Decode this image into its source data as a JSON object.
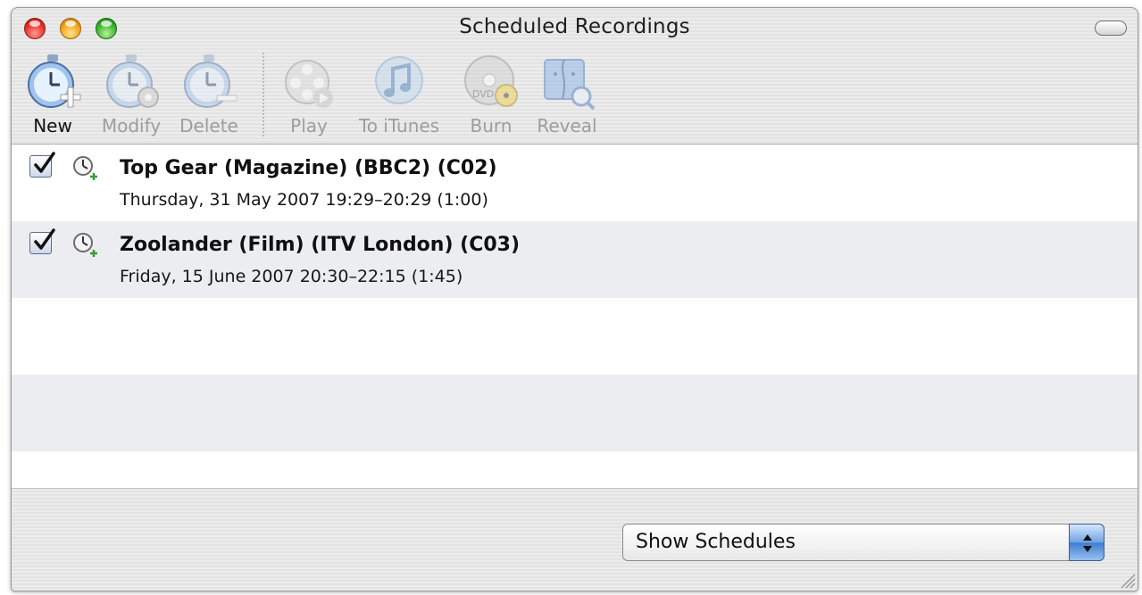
{
  "window": {
    "title": "Scheduled Recordings"
  },
  "toolbar": {
    "items": [
      {
        "label": "New",
        "icon": "stopwatch-add-icon",
        "enabled": true
      },
      {
        "label": "Modify",
        "icon": "stopwatch-modify-icon",
        "enabled": false
      },
      {
        "label": "Delete",
        "icon": "stopwatch-delete-icon",
        "enabled": false
      },
      {
        "label": "Play",
        "icon": "film-reel-play-icon",
        "enabled": false
      },
      {
        "label": "To iTunes",
        "icon": "itunes-note-icon",
        "enabled": false
      },
      {
        "label": "Burn",
        "icon": "dvd-burn-icon",
        "enabled": false
      },
      {
        "label": "Reveal",
        "icon": "finder-reveal-icon",
        "enabled": false
      }
    ]
  },
  "recordings": [
    {
      "checked": true,
      "title": "Top Gear (Magazine) (BBC2) (C02)",
      "time": "Thursday, 31 May 2007  19:29–20:29 (1:00)"
    },
    {
      "checked": true,
      "title": "Zoolander (Film) (ITV London) (C03)",
      "time": "Friday, 15 June 2007  20:30–22:15 (1:45)"
    }
  ],
  "footer": {
    "select_value": "Show Schedules"
  },
  "colors": {
    "row_alt": "#ecedf1",
    "accent_blue": "#3f7dd1",
    "disabled_text": "#9d9d9d"
  }
}
